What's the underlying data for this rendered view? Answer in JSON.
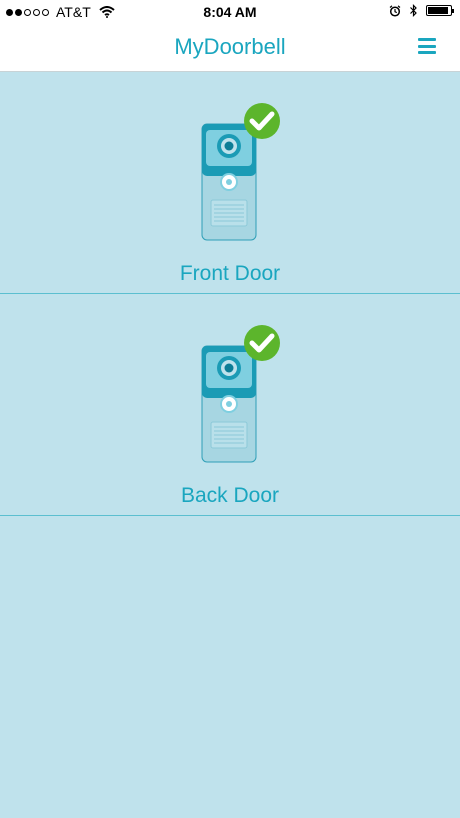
{
  "status_bar": {
    "carrier": "AT&T",
    "time": "8:04 AM",
    "signal_bars_filled": 2,
    "signal_bars_total": 5,
    "battery_level": 0.9
  },
  "nav": {
    "title": "MyDoorbell",
    "menu_icon": "hamburger-menu-icon"
  },
  "devices": [
    {
      "label": "Front Door",
      "status": "connected",
      "icon": "doorbell-device-icon"
    },
    {
      "label": "Back Door",
      "status": "connected",
      "icon": "doorbell-device-icon"
    }
  ],
  "colors": {
    "accent": "#1aa6bf",
    "background": "#bfe2ec",
    "check_green": "#5cb52c"
  }
}
